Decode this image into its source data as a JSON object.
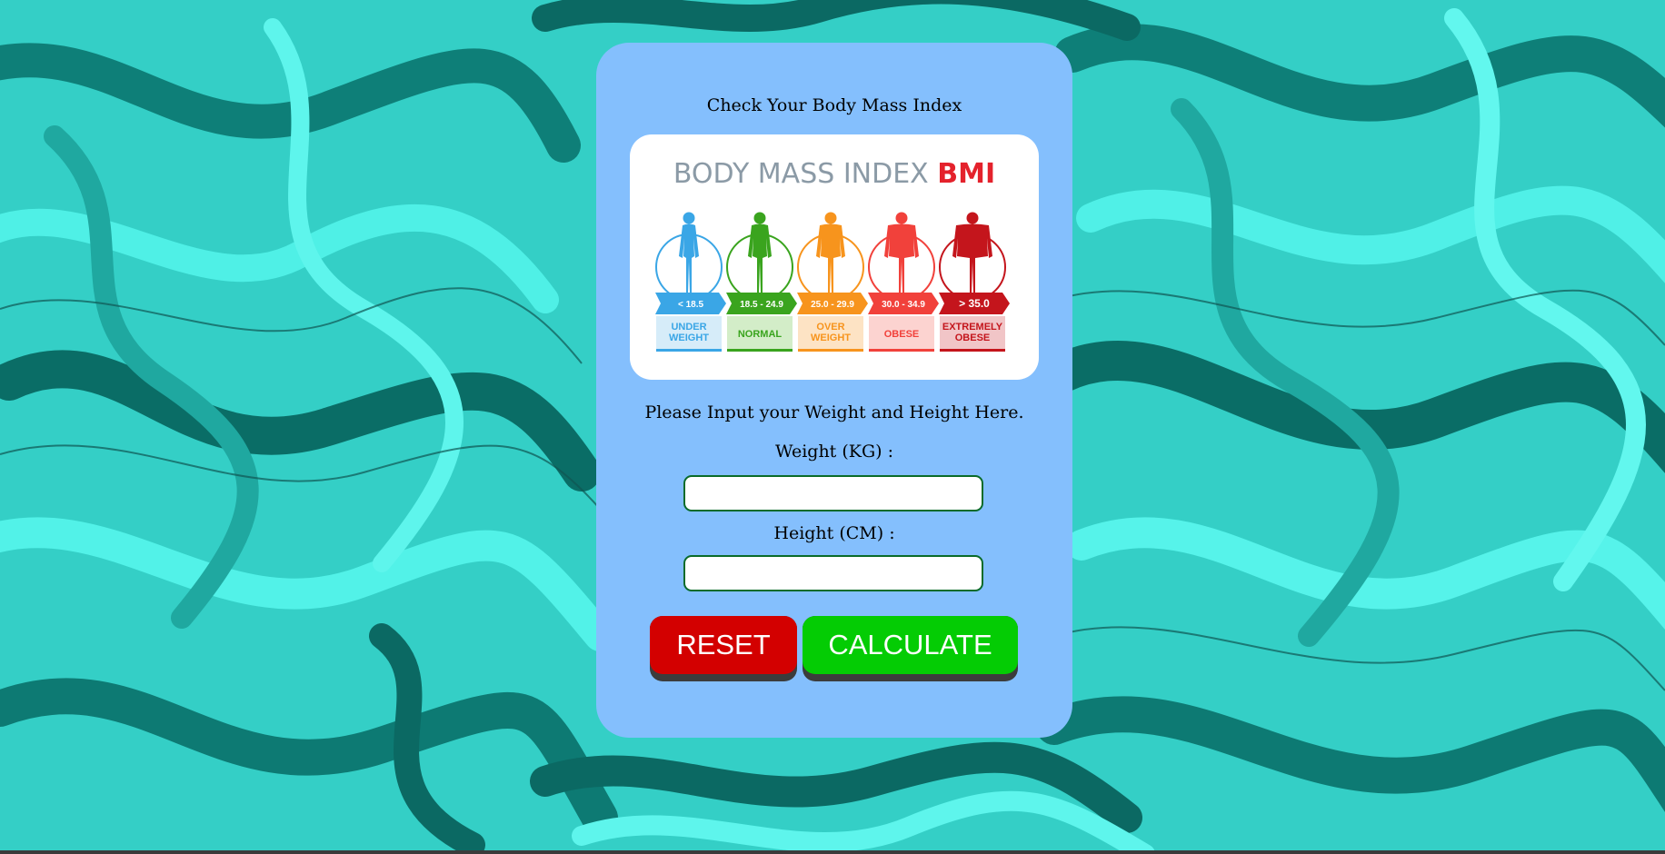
{
  "card": {
    "title": "Check Your Body Mass Index",
    "instruction": "Please Input your Weight and Height Here.",
    "weight_label": "Weight (KG) :",
    "height_label": "Height (CM) :",
    "weight_value": "",
    "height_value": "",
    "reset_label": "RESET",
    "calculate_label": "CALCULATE"
  },
  "bmi_chart": {
    "heading_prefix": "BODY MASS INDEX",
    "heading_accent": "BMI",
    "categories": [
      {
        "range": "< 18.5",
        "line1": "UNDER",
        "line2": "WEIGHT",
        "color": "#3aa6e6",
        "light": "#d6ecf9"
      },
      {
        "range": "18.5 - 24.9",
        "line1": "NORMAL",
        "line2": "",
        "color": "#3aa41e",
        "light": "#d3edc8"
      },
      {
        "range": "25.0 - 29.9",
        "line1": "OVER",
        "line2": "WEIGHT",
        "color": "#f7941d",
        "light": "#fde3c4"
      },
      {
        "range": "30.0 - 34.9",
        "line1": "OBESE",
        "line2": "",
        "color": "#f1413b",
        "light": "#fcd3d0"
      },
      {
        "range": "> 35.0",
        "line1": "EXTREMELY",
        "line2": "OBESE",
        "color": "#c4151c",
        "light": "#f1c5c7"
      }
    ]
  },
  "colors": {
    "card_bg": "#84bffd",
    "reset_button": "#d30000",
    "calculate_button": "#04cc04",
    "field_border": "#0a6b2a"
  }
}
